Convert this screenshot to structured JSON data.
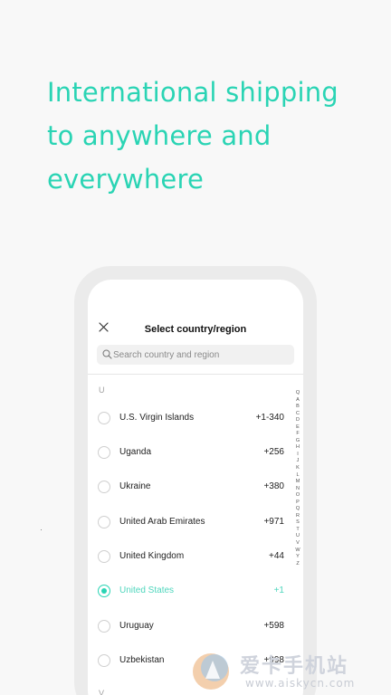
{
  "headline": {
    "line1": "International shipping",
    "line2": "to anywhere and",
    "line3": "everywhere"
  },
  "screen": {
    "title": "Select country/region",
    "search_placeholder": "Search country and region",
    "section_u": "U",
    "section_v": "V",
    "countries": [
      {
        "name": "U.S. Virgin Islands",
        "code": "+1-340",
        "selected": false
      },
      {
        "name": "Uganda",
        "code": "+256",
        "selected": false
      },
      {
        "name": "Ukraine",
        "code": "+380",
        "selected": false
      },
      {
        "name": "United Arab Emirates",
        "code": "+971",
        "selected": false
      },
      {
        "name": "United Kingdom",
        "code": "+44",
        "selected": false
      },
      {
        "name": "United States",
        "code": "+1",
        "selected": true
      },
      {
        "name": "Uruguay",
        "code": "+598",
        "selected": false
      },
      {
        "name": "Uzbekistan",
        "code": "+998",
        "selected": false
      }
    ],
    "alphabet": [
      "Q",
      "A",
      "B",
      "C",
      "D",
      "E",
      "F",
      "G",
      "H",
      "I",
      "J",
      "K",
      "L",
      "M",
      "N",
      "O",
      "P",
      "Q",
      "R",
      "S",
      "T",
      "U",
      "V",
      "W",
      "Y",
      "Z"
    ]
  },
  "watermark": {
    "text": "爱卡手机站",
    "url": "www.aiskycn.com"
  },
  "colors": {
    "accent": "#2ad4b4",
    "background": "#f8f8f8",
    "phone_frame": "#ebebeb"
  },
  "icons": [
    "close-icon",
    "search-icon",
    "watermark-logo-icon"
  ]
}
